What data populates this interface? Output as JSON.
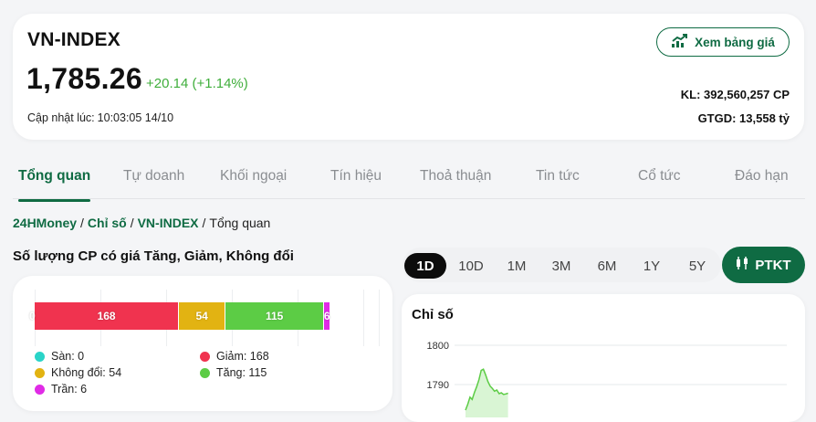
{
  "index": {
    "name": "VN-INDEX",
    "value": "1,785.26",
    "change": "+20.14",
    "change_pct": "(+1.14%)",
    "update_label": "Cập nhật lúc:",
    "update_time": "10:03:05 14/10",
    "price_button": "Xem bảng giá",
    "volume": "KL: 392,560,257 CP",
    "turnover": "GTGD: 13,558 tỷ",
    "up_color": "#3fae3b"
  },
  "tabs": [
    {
      "label": "Tổng quan",
      "active": true
    },
    {
      "label": "Tự doanh"
    },
    {
      "label": "Khối ngoại"
    },
    {
      "label": "Tín hiệu"
    },
    {
      "label": "Thoả thuận"
    },
    {
      "label": "Tin tức"
    },
    {
      "label": "Cổ tức"
    },
    {
      "label": "Đáo hạn"
    }
  ],
  "breadcrumb": {
    "items": [
      "24HMoney",
      "Chỉ số",
      "VN-INDEX"
    ],
    "current": "Tổng quan",
    "separator": "/"
  },
  "breadth": {
    "title": "Số lượng CP có giá Tăng, Giảm, Không đổi",
    "segments": [
      {
        "key": "floor",
        "label": "0",
        "value": 0,
        "color": "#2ad4c8"
      },
      {
        "key": "down",
        "label": "168",
        "value": 168,
        "color": "#f0334f"
      },
      {
        "key": "unchanged",
        "label": "54",
        "value": 54,
        "color": "#e2b312"
      },
      {
        "key": "up",
        "label": "115",
        "value": 115,
        "color": "#5ccc45"
      },
      {
        "key": "ceiling",
        "label": "6",
        "value": 6,
        "color": "#e02be6"
      }
    ],
    "legend": [
      {
        "label": "Sàn: 0",
        "color": "#2ad4c8"
      },
      {
        "label": "Giảm: 168",
        "color": "#f0334f"
      },
      {
        "label": "Không đổi: 54",
        "color": "#e2b312"
      },
      {
        "label": "Tăng: 115",
        "color": "#5ccc45"
      },
      {
        "label": "Trần: 6",
        "color": "#e02be6"
      }
    ]
  },
  "ranges": [
    {
      "label": "1D",
      "active": true
    },
    {
      "label": "10D"
    },
    {
      "label": "1M"
    },
    {
      "label": "3M"
    },
    {
      "label": "6M"
    },
    {
      "label": "1Y"
    },
    {
      "label": "5Y"
    }
  ],
  "ptkt_label": "PTKT",
  "chart_data": {
    "type": "area",
    "title": "Chỉ số",
    "ylabel": "",
    "xlabel": "",
    "y_ticks": [
      1800,
      1790
    ],
    "ylim": [
      1783,
      1803
    ],
    "x": [
      0,
      1,
      2,
      3,
      4,
      5,
      6,
      7,
      8,
      9,
      10,
      11,
      12,
      13,
      14,
      15,
      16,
      17,
      18,
      19
    ],
    "values": [
      1783.5,
      1785.0,
      1786.8,
      1786.2,
      1788.0,
      1789.5,
      1791.2,
      1793.6,
      1793.9,
      1792.5,
      1790.8,
      1789.6,
      1789.0,
      1788.3,
      1788.6,
      1787.7,
      1787.9,
      1787.5,
      1787.6,
      1787.8
    ],
    "line_color": "#5ccc45",
    "fill_color": "#d9f5d4",
    "grid": true
  }
}
